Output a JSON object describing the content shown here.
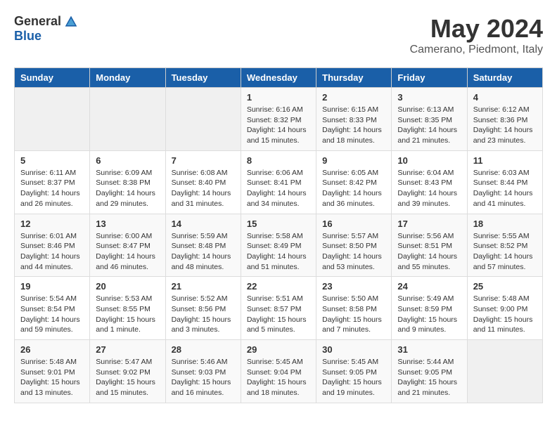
{
  "header": {
    "logo_general": "General",
    "logo_blue": "Blue",
    "month_title": "May 2024",
    "subtitle": "Camerano, Piedmont, Italy"
  },
  "days_of_week": [
    "Sunday",
    "Monday",
    "Tuesday",
    "Wednesday",
    "Thursday",
    "Friday",
    "Saturday"
  ],
  "weeks": [
    [
      {
        "day": "",
        "info": ""
      },
      {
        "day": "",
        "info": ""
      },
      {
        "day": "",
        "info": ""
      },
      {
        "day": "1",
        "info": "Sunrise: 6:16 AM\nSunset: 8:32 PM\nDaylight: 14 hours and 15 minutes."
      },
      {
        "day": "2",
        "info": "Sunrise: 6:15 AM\nSunset: 8:33 PM\nDaylight: 14 hours and 18 minutes."
      },
      {
        "day": "3",
        "info": "Sunrise: 6:13 AM\nSunset: 8:35 PM\nDaylight: 14 hours and 21 minutes."
      },
      {
        "day": "4",
        "info": "Sunrise: 6:12 AM\nSunset: 8:36 PM\nDaylight: 14 hours and 23 minutes."
      }
    ],
    [
      {
        "day": "5",
        "info": "Sunrise: 6:11 AM\nSunset: 8:37 PM\nDaylight: 14 hours and 26 minutes."
      },
      {
        "day": "6",
        "info": "Sunrise: 6:09 AM\nSunset: 8:38 PM\nDaylight: 14 hours and 29 minutes."
      },
      {
        "day": "7",
        "info": "Sunrise: 6:08 AM\nSunset: 8:40 PM\nDaylight: 14 hours and 31 minutes."
      },
      {
        "day": "8",
        "info": "Sunrise: 6:06 AM\nSunset: 8:41 PM\nDaylight: 14 hours and 34 minutes."
      },
      {
        "day": "9",
        "info": "Sunrise: 6:05 AM\nSunset: 8:42 PM\nDaylight: 14 hours and 36 minutes."
      },
      {
        "day": "10",
        "info": "Sunrise: 6:04 AM\nSunset: 8:43 PM\nDaylight: 14 hours and 39 minutes."
      },
      {
        "day": "11",
        "info": "Sunrise: 6:03 AM\nSunset: 8:44 PM\nDaylight: 14 hours and 41 minutes."
      }
    ],
    [
      {
        "day": "12",
        "info": "Sunrise: 6:01 AM\nSunset: 8:46 PM\nDaylight: 14 hours and 44 minutes."
      },
      {
        "day": "13",
        "info": "Sunrise: 6:00 AM\nSunset: 8:47 PM\nDaylight: 14 hours and 46 minutes."
      },
      {
        "day": "14",
        "info": "Sunrise: 5:59 AM\nSunset: 8:48 PM\nDaylight: 14 hours and 48 minutes."
      },
      {
        "day": "15",
        "info": "Sunrise: 5:58 AM\nSunset: 8:49 PM\nDaylight: 14 hours and 51 minutes."
      },
      {
        "day": "16",
        "info": "Sunrise: 5:57 AM\nSunset: 8:50 PM\nDaylight: 14 hours and 53 minutes."
      },
      {
        "day": "17",
        "info": "Sunrise: 5:56 AM\nSunset: 8:51 PM\nDaylight: 14 hours and 55 minutes."
      },
      {
        "day": "18",
        "info": "Sunrise: 5:55 AM\nSunset: 8:52 PM\nDaylight: 14 hours and 57 minutes."
      }
    ],
    [
      {
        "day": "19",
        "info": "Sunrise: 5:54 AM\nSunset: 8:54 PM\nDaylight: 14 hours and 59 minutes."
      },
      {
        "day": "20",
        "info": "Sunrise: 5:53 AM\nSunset: 8:55 PM\nDaylight: 15 hours and 1 minute."
      },
      {
        "day": "21",
        "info": "Sunrise: 5:52 AM\nSunset: 8:56 PM\nDaylight: 15 hours and 3 minutes."
      },
      {
        "day": "22",
        "info": "Sunrise: 5:51 AM\nSunset: 8:57 PM\nDaylight: 15 hours and 5 minutes."
      },
      {
        "day": "23",
        "info": "Sunrise: 5:50 AM\nSunset: 8:58 PM\nDaylight: 15 hours and 7 minutes."
      },
      {
        "day": "24",
        "info": "Sunrise: 5:49 AM\nSunset: 8:59 PM\nDaylight: 15 hours and 9 minutes."
      },
      {
        "day": "25",
        "info": "Sunrise: 5:48 AM\nSunset: 9:00 PM\nDaylight: 15 hours and 11 minutes."
      }
    ],
    [
      {
        "day": "26",
        "info": "Sunrise: 5:48 AM\nSunset: 9:01 PM\nDaylight: 15 hours and 13 minutes."
      },
      {
        "day": "27",
        "info": "Sunrise: 5:47 AM\nSunset: 9:02 PM\nDaylight: 15 hours and 15 minutes."
      },
      {
        "day": "28",
        "info": "Sunrise: 5:46 AM\nSunset: 9:03 PM\nDaylight: 15 hours and 16 minutes."
      },
      {
        "day": "29",
        "info": "Sunrise: 5:45 AM\nSunset: 9:04 PM\nDaylight: 15 hours and 18 minutes."
      },
      {
        "day": "30",
        "info": "Sunrise: 5:45 AM\nSunset: 9:05 PM\nDaylight: 15 hours and 19 minutes."
      },
      {
        "day": "31",
        "info": "Sunrise: 5:44 AM\nSunset: 9:05 PM\nDaylight: 15 hours and 21 minutes."
      },
      {
        "day": "",
        "info": ""
      }
    ]
  ]
}
